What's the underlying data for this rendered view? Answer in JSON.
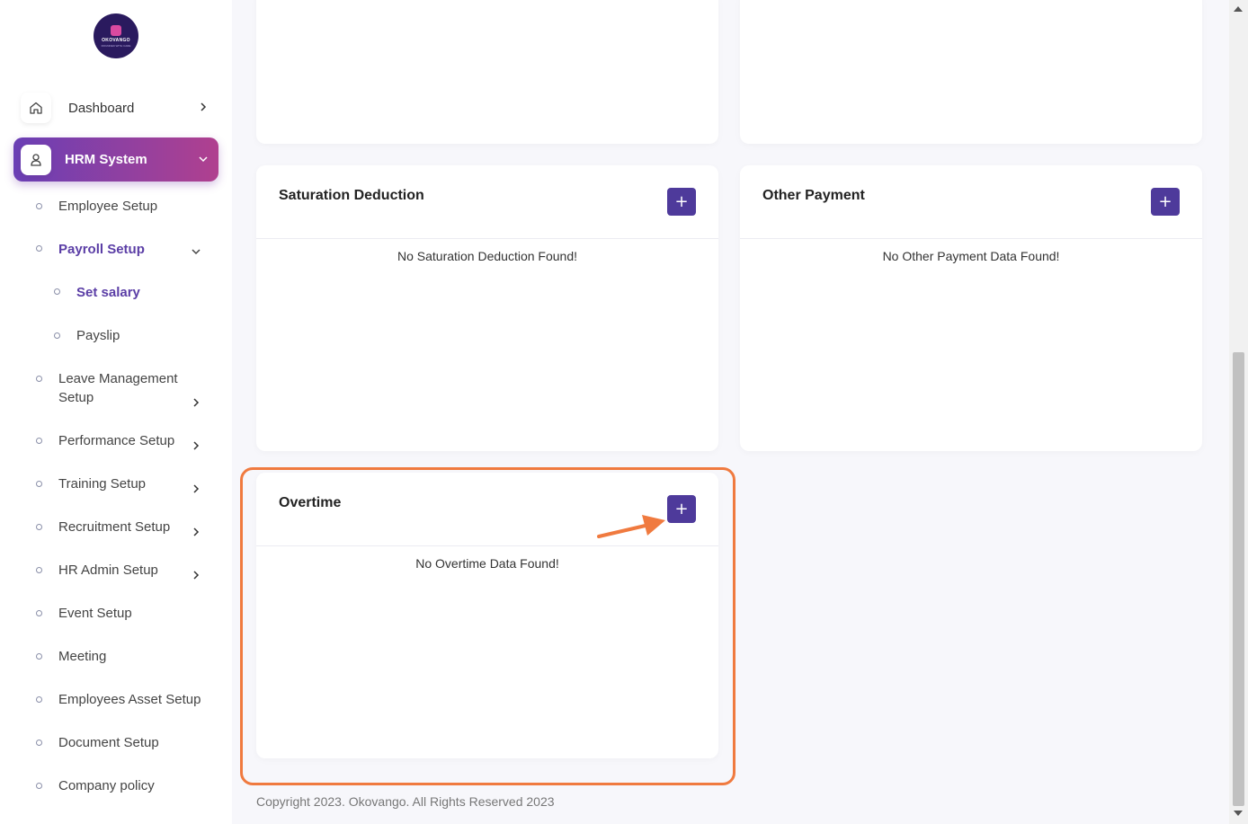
{
  "brand": {
    "logo_text": "OKOVANGO",
    "logo_sub": "ROUNDED WITH CARE"
  },
  "sidebar": {
    "dashboard_label": "Dashboard",
    "hrm_label": "HRM System",
    "items": [
      {
        "label": "Employee Setup"
      },
      {
        "label": "Payroll Setup"
      },
      {
        "label": "Set salary"
      },
      {
        "label": "Payslip"
      },
      {
        "label": "Leave Management",
        "label2": "Setup"
      },
      {
        "label": "Performance Setup"
      },
      {
        "label": "Training Setup"
      },
      {
        "label": "Recruitment Setup"
      },
      {
        "label": "HR Admin Setup"
      },
      {
        "label": "Event Setup"
      },
      {
        "label": "Meeting"
      },
      {
        "label": "Employees Asset Setup"
      },
      {
        "label": "Document Setup"
      },
      {
        "label": "Company policy"
      }
    ]
  },
  "cards": {
    "saturation": {
      "title": "Saturation Deduction",
      "empty": "No Saturation Deduction Found!",
      "add": "+"
    },
    "other_payment": {
      "title": "Other Payment",
      "empty": "No Other Payment Data Found!",
      "add": "+"
    },
    "overtime": {
      "title": "Overtime",
      "empty": "No Overtime Data Found!",
      "add": "+"
    }
  },
  "footer": {
    "copyright": "Copyright 2023. Okovango. All Rights Reserved 2023"
  },
  "colors": {
    "accent": "#4e3a9b",
    "highlight": "#f07a3f",
    "active_text": "#5b3ea6"
  }
}
